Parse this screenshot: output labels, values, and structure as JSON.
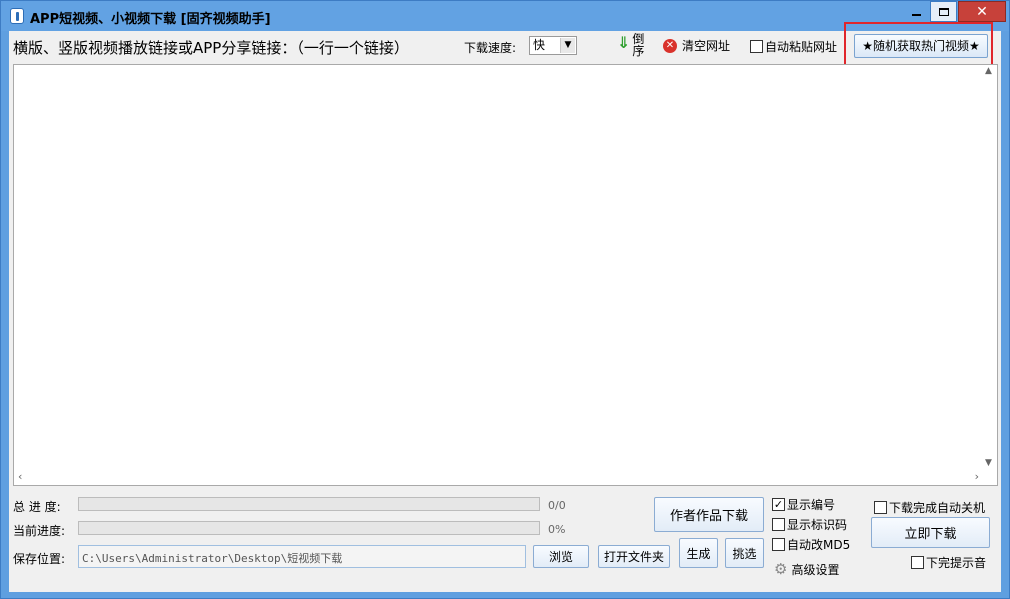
{
  "window": {
    "title": "APP短视频、小视频下载 [固齐视频助手]",
    "close_glyph": "✕"
  },
  "toolbar": {
    "links_label": "横版、竖版视频播放链接或APP分享链接：（一行一个链接）",
    "speed_label": "下载速度:",
    "speed_value": "快",
    "reverse_label": "倒序",
    "clear_label": "清空网址",
    "autopaste_label": "自动粘贴网址",
    "autopaste_checked": false,
    "hot_videos_label": "★随机获取热门视频★"
  },
  "link_input": {
    "value": ""
  },
  "progress": {
    "total_label": "总 进 度:",
    "total_text": "0/0",
    "total_fraction": 0,
    "current_label": "当前进度:",
    "current_text": "0%",
    "current_fraction": 0
  },
  "save": {
    "label": "保存位置:",
    "path": "C:\\Users\\Administrator\\Desktop\\短视频下载",
    "browse_label": "浏览",
    "open_folder_label": "打开文件夹"
  },
  "actions": {
    "author_download_label": "作者作品下载",
    "generate_label": "生成",
    "pick_label": "挑选",
    "download_now_label": "立即下载"
  },
  "options": {
    "show_number_label": "显示编号",
    "show_number_checked": true,
    "show_tag_label": "显示标识码",
    "show_tag_checked": false,
    "auto_md5_label": "自动改MD5",
    "auto_md5_checked": false,
    "advanced_label": "高级设置",
    "shutdown_label": "下载完成自动关机",
    "shutdown_checked": false,
    "sound_label": "下完提示音",
    "sound_checked": false
  },
  "colors": {
    "titlebar": "#62a2e3",
    "close_button": "#c7413a",
    "highlight": "#e0262b",
    "progress_fill": "#06b025"
  }
}
